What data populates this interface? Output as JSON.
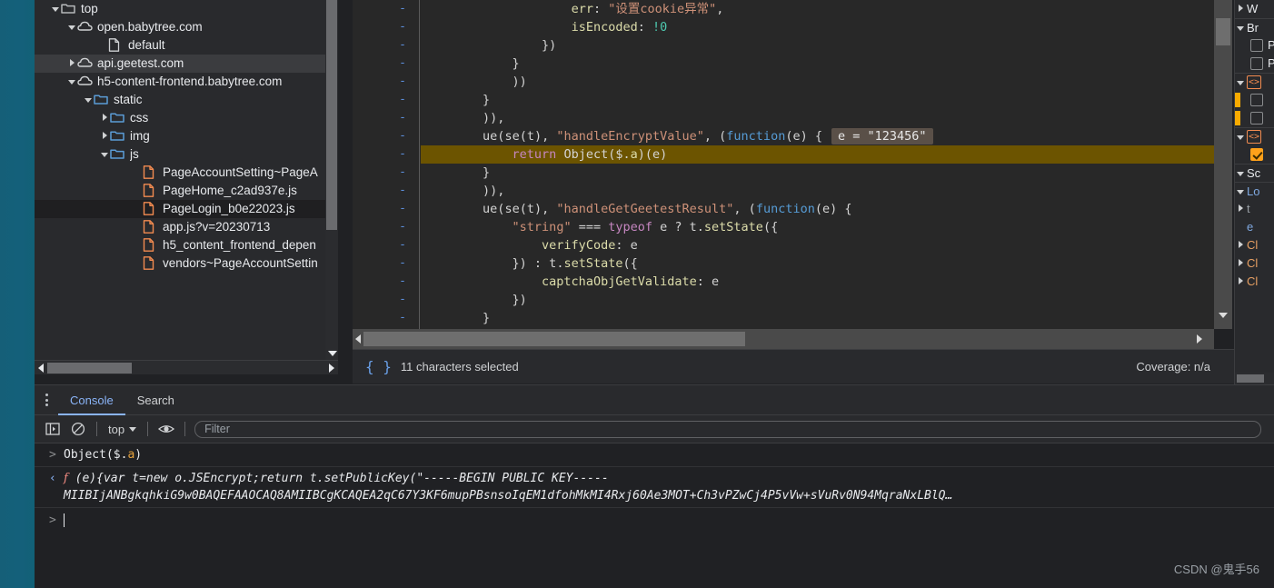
{
  "theme": {
    "accent_teal": "#14607a",
    "panel_bg": "#292a2d",
    "editor_bg": "#282828",
    "console_bg": "#202124",
    "highlight_line": "#6c5400",
    "link_blue": "#8ab4f8",
    "file_icon_orange": "#f28b50",
    "folder_blue": "#5b9cd6"
  },
  "navigator": {
    "items": [
      {
        "label": "top",
        "indent": 18,
        "twisty": "down",
        "icon": "folder-icon",
        "state": "normal"
      },
      {
        "label": "open.babytree.com",
        "indent": 36,
        "twisty": "down",
        "icon": "cloud-icon",
        "state": "normal"
      },
      {
        "label": "default",
        "indent": 70,
        "twisty": "none",
        "icon": "document-icon",
        "state": "normal"
      },
      {
        "label": "api.geetest.com",
        "indent": 36,
        "twisty": "right",
        "icon": "cloud-icon",
        "state": "selected-light"
      },
      {
        "label": "h5-content-frontend.babytree.com",
        "indent": 36,
        "twisty": "down",
        "icon": "cloud-icon",
        "state": "normal"
      },
      {
        "label": "static",
        "indent": 54,
        "twisty": "down",
        "icon": "folder-open-icon",
        "state": "normal"
      },
      {
        "label": "css",
        "indent": 72,
        "twisty": "right",
        "icon": "folder-open-icon",
        "state": "normal"
      },
      {
        "label": "img",
        "indent": 72,
        "twisty": "right",
        "icon": "folder-open-icon",
        "state": "normal"
      },
      {
        "label": "js",
        "indent": 72,
        "twisty": "down",
        "icon": "folder-open-icon",
        "state": "normal"
      },
      {
        "label": "PageAccountSetting~PageA",
        "indent": 108,
        "twisty": "none",
        "icon": "js-file-icon",
        "state": "normal"
      },
      {
        "label": "PageHome_c2ad937e.js",
        "indent": 108,
        "twisty": "none",
        "icon": "js-file-icon",
        "state": "normal"
      },
      {
        "label": "PageLogin_b0e22023.js",
        "indent": 108,
        "twisty": "none",
        "icon": "js-file-icon",
        "state": "selected-dark"
      },
      {
        "label": "app.js?v=20230713",
        "indent": 108,
        "twisty": "none",
        "icon": "js-file-icon",
        "state": "normal"
      },
      {
        "label": "h5_content_frontend_depen",
        "indent": 108,
        "twisty": "none",
        "icon": "js-file-icon",
        "state": "normal"
      },
      {
        "label": "vendors~PageAccountSettin",
        "indent": 108,
        "twisty": "none",
        "icon": "js-file-icon",
        "state": "normal"
      }
    ]
  },
  "editor": {
    "gutter_marks": [
      "-",
      "-",
      "-",
      "-",
      "-",
      "-",
      "-",
      "-",
      "-",
      "-",
      "-",
      "-",
      "-",
      "-",
      "-",
      "-",
      "-",
      "-"
    ],
    "inline_value": "e = \"123456\"",
    "lines": [
      {
        "highlight": false,
        "segments": [
          {
            "t": "                    ",
            "c": "plain"
          },
          {
            "t": "err",
            "c": "prop"
          },
          {
            "t": ": ",
            "c": "punc"
          },
          {
            "t": "\"设置cookie异常\"",
            "c": "str"
          },
          {
            "t": ",",
            "c": "punc"
          }
        ]
      },
      {
        "highlight": false,
        "segments": [
          {
            "t": "                    ",
            "c": "plain"
          },
          {
            "t": "isEncoded",
            "c": "prop"
          },
          {
            "t": ": ",
            "c": "punc"
          },
          {
            "t": "!0",
            "c": "num"
          }
        ]
      },
      {
        "highlight": false,
        "segments": [
          {
            "t": "                ",
            "c": "plain"
          },
          {
            "t": "})",
            "c": "punc"
          }
        ]
      },
      {
        "highlight": false,
        "segments": [
          {
            "t": "            ",
            "c": "plain"
          },
          {
            "t": "}",
            "c": "punc"
          }
        ]
      },
      {
        "highlight": false,
        "segments": [
          {
            "t": "            ",
            "c": "plain"
          },
          {
            "t": "))",
            "c": "punc"
          }
        ]
      },
      {
        "highlight": false,
        "segments": [
          {
            "t": "        ",
            "c": "plain"
          },
          {
            "t": "}",
            "c": "punc"
          }
        ]
      },
      {
        "highlight": false,
        "segments": [
          {
            "t": "        ",
            "c": "plain"
          },
          {
            "t": ")),",
            "c": "punc"
          }
        ]
      },
      {
        "highlight": false,
        "segments": [
          {
            "t": "        ",
            "c": "plain"
          },
          {
            "t": "ue",
            "c": "plain"
          },
          {
            "t": "(",
            "c": "punc"
          },
          {
            "t": "se",
            "c": "plain"
          },
          {
            "t": "(t), ",
            "c": "punc"
          },
          {
            "t": "\"handleEncryptValue\"",
            "c": "str"
          },
          {
            "t": ", (",
            "c": "punc"
          },
          {
            "t": "function",
            "c": "fn"
          },
          {
            "t": "(e) {",
            "c": "punc"
          }
        ],
        "inline_value": true
      },
      {
        "highlight": true,
        "segments": [
          {
            "t": "            ",
            "c": "plain"
          },
          {
            "t": "return",
            "c": "kw"
          },
          {
            "t": " Object($.",
            "c": "plain"
          },
          {
            "t": "a",
            "c": "var"
          },
          {
            "t": ")(e)",
            "c": "plain"
          }
        ]
      },
      {
        "highlight": false,
        "segments": [
          {
            "t": "        ",
            "c": "plain"
          },
          {
            "t": "}",
            "c": "punc"
          }
        ]
      },
      {
        "highlight": false,
        "segments": [
          {
            "t": "        ",
            "c": "plain"
          },
          {
            "t": ")),",
            "c": "punc"
          }
        ]
      },
      {
        "highlight": false,
        "segments": [
          {
            "t": "        ",
            "c": "plain"
          },
          {
            "t": "ue",
            "c": "plain"
          },
          {
            "t": "(",
            "c": "punc"
          },
          {
            "t": "se",
            "c": "plain"
          },
          {
            "t": "(t), ",
            "c": "punc"
          },
          {
            "t": "\"handleGetGeetestResult\"",
            "c": "str"
          },
          {
            "t": ", (",
            "c": "punc"
          },
          {
            "t": "function",
            "c": "fn"
          },
          {
            "t": "(e) {",
            "c": "punc"
          }
        ]
      },
      {
        "highlight": false,
        "segments": [
          {
            "t": "            ",
            "c": "plain"
          },
          {
            "t": "\"string\"",
            "c": "str"
          },
          {
            "t": " === ",
            "c": "plain"
          },
          {
            "t": "typeof",
            "c": "kw"
          },
          {
            "t": " e ? t.",
            "c": "plain"
          },
          {
            "t": "setState",
            "c": "var"
          },
          {
            "t": "({",
            "c": "punc"
          }
        ]
      },
      {
        "highlight": false,
        "segments": [
          {
            "t": "                ",
            "c": "plain"
          },
          {
            "t": "verifyCode",
            "c": "prop"
          },
          {
            "t": ": e",
            "c": "plain"
          }
        ]
      },
      {
        "highlight": false,
        "segments": [
          {
            "t": "            ",
            "c": "plain"
          },
          {
            "t": "}) : t.",
            "c": "plain"
          },
          {
            "t": "setState",
            "c": "var"
          },
          {
            "t": "({",
            "c": "punc"
          }
        ]
      },
      {
        "highlight": false,
        "segments": [
          {
            "t": "                ",
            "c": "plain"
          },
          {
            "t": "captchaObjGetValidate",
            "c": "prop"
          },
          {
            "t": ": e",
            "c": "plain"
          }
        ]
      },
      {
        "highlight": false,
        "segments": [
          {
            "t": "            ",
            "c": "plain"
          },
          {
            "t": "})",
            "c": "punc"
          }
        ]
      },
      {
        "highlight": false,
        "segments": [
          {
            "t": "        ",
            "c": "plain"
          },
          {
            "t": "}",
            "c": "punc"
          }
        ]
      }
    ]
  },
  "statusbar": {
    "format_icon": "{ }",
    "selection_text": "11 characters selected",
    "coverage_text": "Coverage: n/a"
  },
  "rightbar": {
    "rows": [
      {
        "label": "W",
        "twisty": "right",
        "kind": "section"
      },
      {
        "label": "Br",
        "twisty": "down",
        "kind": "section",
        "divider": true
      },
      {
        "label": "Pa",
        "twisty": "none",
        "kind": "checkbox",
        "checked": false
      },
      {
        "label": "Pa",
        "twisty": "none",
        "kind": "checkbox",
        "checked": false
      },
      {
        "label": "",
        "twisty": "down",
        "kind": "breakpoint-group",
        "divider": true
      },
      {
        "label": "",
        "twisty": "none",
        "kind": "checkbox",
        "checked": false,
        "mark": true
      },
      {
        "label": "",
        "twisty": "none",
        "kind": "checkbox",
        "checked": false,
        "mark": true
      },
      {
        "label": "",
        "twisty": "down",
        "kind": "breakpoint-group",
        "divider": true
      },
      {
        "label": "",
        "twisty": "none",
        "kind": "checkbox",
        "checked": true
      },
      {
        "label": "Sc",
        "twisty": "down",
        "kind": "section",
        "divider": true
      },
      {
        "label": "Lo",
        "twisty": "down",
        "kind": "scope",
        "color": "blue",
        "divider": true
      },
      {
        "label": "t",
        "twisty": "right",
        "kind": "scope-child",
        "color": "dim"
      },
      {
        "label": "e",
        "twisty": "none",
        "kind": "scope-child",
        "color": "blue"
      },
      {
        "label": "Cl",
        "twisty": "right",
        "kind": "scope",
        "color": "orange"
      },
      {
        "label": "Cl",
        "twisty": "right",
        "kind": "scope",
        "color": "orange"
      },
      {
        "label": "Cl",
        "twisty": "right",
        "kind": "scope",
        "color": "orange"
      }
    ]
  },
  "drawer": {
    "tabs": [
      {
        "label": "Console",
        "active": true
      },
      {
        "label": "Search",
        "active": false
      }
    ],
    "more_icon": "kebab-menu-icon",
    "toolbar": {
      "sidebar_icon": "console-sidebar-icon",
      "clear_icon": "clear-console-icon",
      "context_value": "top",
      "eye_icon": "live-expression-eye-icon",
      "filter_placeholder": "Filter",
      "filter_value": ""
    },
    "messages": [
      {
        "marker": ">",
        "type": "input",
        "text": "Object($.a)",
        "tokens": [
          {
            "t": "Object($.",
            "c": "plain"
          },
          {
            "t": "a",
            "c": "gold"
          },
          {
            "t": ")",
            "c": "plain"
          }
        ]
      },
      {
        "marker": "<",
        "type": "output",
        "fn_glyph": "f",
        "line1": "(e){var t=new o.JSEncrypt;return t.setPublicKey(\"-----BEGIN PUBLIC KEY-----",
        "line2": "MIIBIjANBgkqhkiG9w0BAQEFAAOCAQ8AMIIBCgKCAQEA2qC67Y3KF6mupPBsnsoIqEM1dfohMkMI4Rxj60Ae3MOT+Ch3vPZwCj4P5vVw+sVuRv0N94MqraNxLBlQ…"
      }
    ],
    "prompt_marker": ">"
  },
  "watermark": "CSDN @鬼手56"
}
